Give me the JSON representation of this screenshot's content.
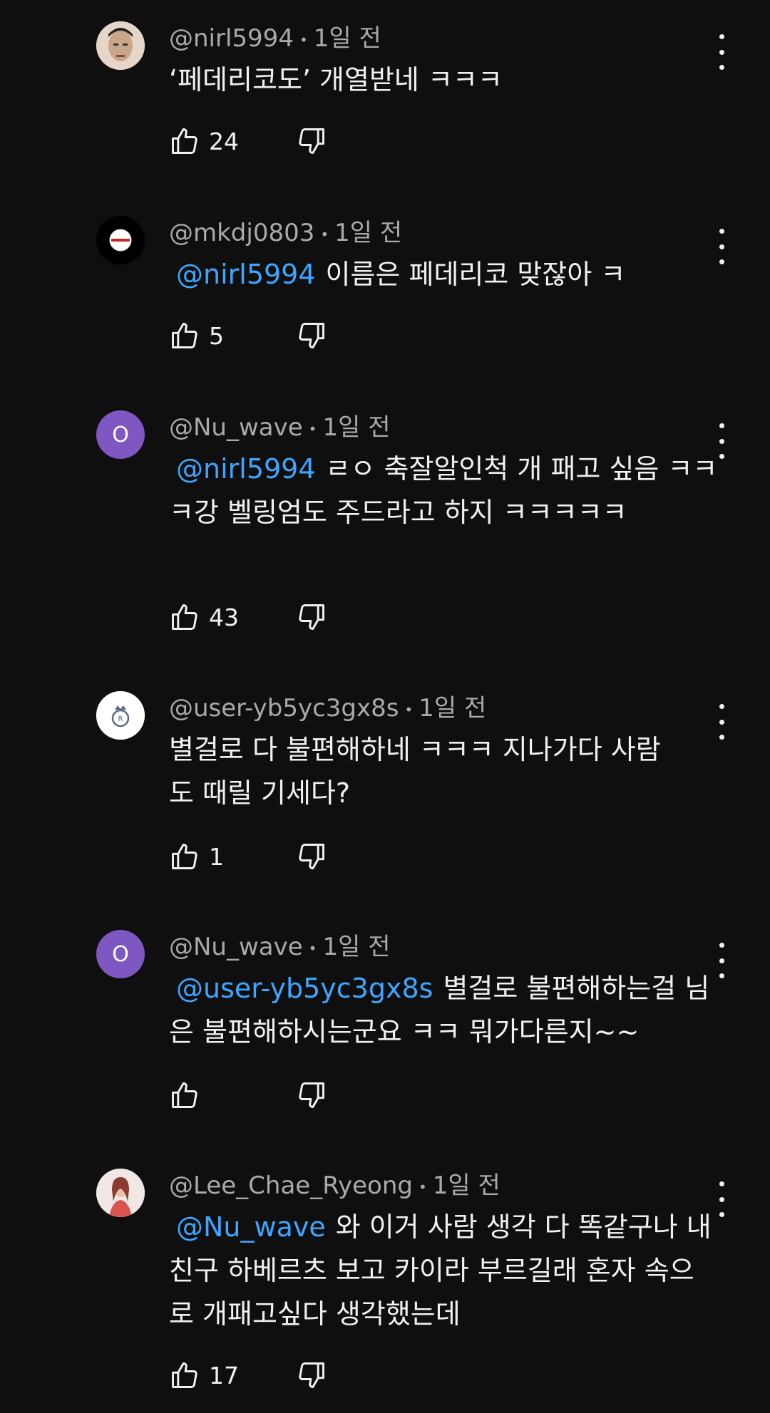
{
  "comments": [
    {
      "author": "@nirl5994",
      "time": "1일 전",
      "mention": "",
      "text": "‘페데리코도’ 개열받네 ㅋㅋㅋ",
      "likes": "24",
      "avatar": {
        "type": "photo",
        "letter": ""
      }
    },
    {
      "author": "@mkdj0803",
      "time": "1일 전",
      "mention": "@nirl5994",
      "text": "이름은 페데리코 맞잖아 ㅋ",
      "likes": "5",
      "avatar": {
        "type": "dark-logo",
        "letter": ""
      }
    },
    {
      "author": "@Nu_wave",
      "time": "1일 전",
      "mention": "@nirl5994",
      "text": "ㄹㅇ 축잘알인척 개 패고 싶음 ㅋㅋㅋ강 벨링엄도 주드라고 하지 ㅋㅋㅋㅋㅋ",
      "likes": "43",
      "avatar": {
        "type": "letter",
        "letter": "O"
      }
    },
    {
      "author": "@user-yb5yc3gx8s",
      "time": "1일 전",
      "mention": "",
      "text": "별걸로 다 불편해하네 ㅋㅋㅋ 지나가다 사람도 때릴 기세다?",
      "likes": "1",
      "avatar": {
        "type": "crest",
        "letter": ""
      }
    },
    {
      "author": "@Nu_wave",
      "time": "1일 전",
      "mention": "@user-yb5yc3gx8s",
      "text": "별걸로 불편해하는걸 님은 불편해하시는군요 ㅋㅋ 뭐가다른지~~",
      "likes": "",
      "avatar": {
        "type": "letter",
        "letter": "O"
      }
    },
    {
      "author": "@Lee_Chae_Ryeong",
      "time": "1일 전",
      "mention": "@Nu_wave",
      "text": "와 이거 사람 생각 다 똑같구나 내친구 하베르츠 보고 카이라 부르길래 혼자 속으로 개패고싶다 생각했는데",
      "likes": "17",
      "avatar": {
        "type": "photo-pink",
        "letter": ""
      }
    }
  ],
  "colors": {
    "background": "#0f0f0f",
    "mention": "#3ea6ff",
    "avatar_letter_bg": "#7e57c2"
  }
}
